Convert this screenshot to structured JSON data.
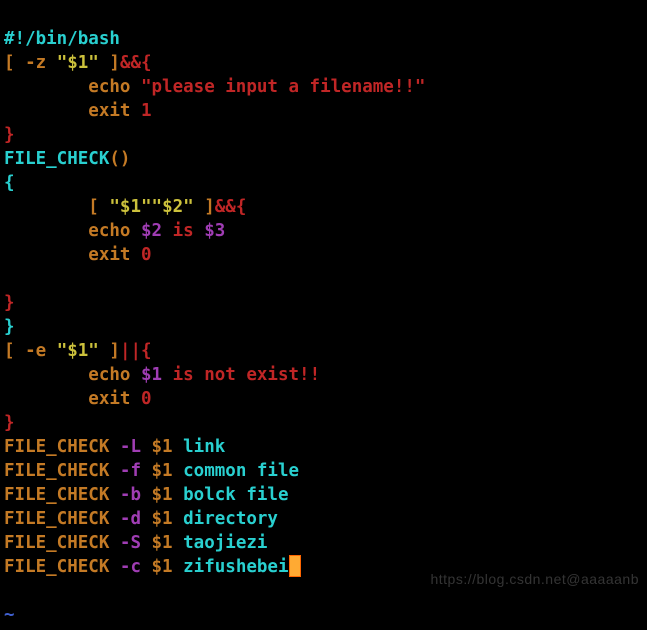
{
  "code": {
    "l1": {
      "a": "#!/bin/bash"
    },
    "l2": {
      "a": "[",
      "b": " -z ",
      "c": "\"$1\"",
      "d": " ]",
      "e": "&&{"
    },
    "l3": {
      "a": "        ",
      "b": "echo ",
      "c": "\"please input a filename!!\""
    },
    "l4": {
      "a": "        ",
      "b": "exit ",
      "c": "1"
    },
    "l5": {
      "a": "}"
    },
    "l6": {
      "a": "FILE_CHECK",
      "b": "()"
    },
    "l7": {
      "a": "{"
    },
    "l8": {
      "a": "        ",
      "b": "[",
      "c": " ",
      "d": "\"$1\"\"$2\"",
      "e": " ]",
      "f": "&&{"
    },
    "l9": {
      "a": "        ",
      "b": "echo ",
      "c": "$2",
      "d": " is ",
      "e": "$3"
    },
    "l10": {
      "a": "        ",
      "b": "exit ",
      "c": "0"
    },
    "l11": {
      "a": ""
    },
    "l12": {
      "a": "}"
    },
    "l13": {
      "a": "}"
    },
    "l14": {
      "a": "[",
      "b": " -e ",
      "c": "\"$1\"",
      "d": " ]",
      "e": "||{"
    },
    "l15": {
      "a": "        ",
      "b": "echo ",
      "c": "$1",
      "d": " is not exist!!"
    },
    "l16": {
      "a": "        ",
      "b": "exit ",
      "c": "0"
    },
    "l17": {
      "a": "}"
    },
    "l18": {
      "a": "FILE_CHECK ",
      "b": "-L",
      "c": " $1 ",
      "d": "link"
    },
    "l19": {
      "a": "FILE_CHECK ",
      "b": "-f",
      "c": " $1 ",
      "d": "common file"
    },
    "l20": {
      "a": "FILE_CHECK ",
      "b": "-b",
      "c": " $1 ",
      "d": "bolck file"
    },
    "l21": {
      "a": "FILE_CHECK ",
      "b": "-d",
      "c": " $1 ",
      "d": "directory"
    },
    "l22": {
      "a": "FILE_CHECK ",
      "b": "-S",
      "c": " $1 ",
      "d": "taojiezi"
    },
    "l23": {
      "a": "FILE_CHECK ",
      "b": "-c",
      "c": " $1 ",
      "d": "zifushebei"
    },
    "tilde": "~"
  },
  "watermark": "https://blog.csdn.net@aaaaanb"
}
